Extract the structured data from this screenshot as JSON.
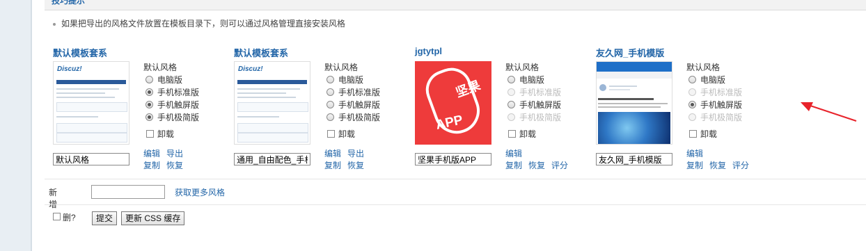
{
  "tip": {
    "header": "技巧提示",
    "line": "如果把导出的风格文件放置在模板目录下，则可以通过风格管理直接安装风格"
  },
  "cards": [
    {
      "title": "默认模板套系",
      "name_value": "默认风格",
      "default_label": "默认风格",
      "options": [
        "电脑版",
        "手机标准版",
        "手机触屏版",
        "手机极简版"
      ],
      "uninstall": "卸载",
      "actions_row1": [
        "编辑",
        "导出"
      ],
      "actions_row2": [
        "复制",
        "恢复"
      ]
    },
    {
      "title": "默认模板套系",
      "name_value": "通用_自由配色_手机",
      "default_label": "默认风格",
      "options": [
        "电脑版",
        "手机标准版",
        "手机触屏版",
        "手机极简版"
      ],
      "uninstall": "卸载",
      "actions_row1": [
        "编辑",
        "导出"
      ],
      "actions_row2": [
        "复制",
        "恢复"
      ]
    },
    {
      "title": "jgtytpl",
      "name_value": "坚果手机版APP",
      "default_label": "默认风格",
      "options": [
        "电脑版",
        "手机标准版",
        "手机触屏版",
        "手机极简版"
      ],
      "uninstall": "卸载",
      "actions_row1": [
        "编辑"
      ],
      "actions_row2": [
        "复制",
        "恢复",
        "评分"
      ],
      "icon_text_top": "坚果",
      "icon_text_bottom": "APP"
    },
    {
      "title": "友久网_手机模版",
      "name_value": "友久网_手机模版",
      "default_label": "默认风格",
      "options": [
        "电脑版",
        "手机标准版",
        "手机触屏版",
        "手机极简版"
      ],
      "uninstall": "卸载",
      "actions_row1": [
        "编辑"
      ],
      "actions_row2": [
        "复制",
        "恢复",
        "评分"
      ]
    }
  ],
  "add": {
    "label": "新增",
    "link": "获取更多风格"
  },
  "footer": {
    "delete_label": "删?",
    "submit": "提交",
    "update_css": "更新 CSS 缓存"
  },
  "colors": {
    "link": "#2366a8",
    "accent_red": "#ee3b3b",
    "arrow": "#e8232b"
  }
}
